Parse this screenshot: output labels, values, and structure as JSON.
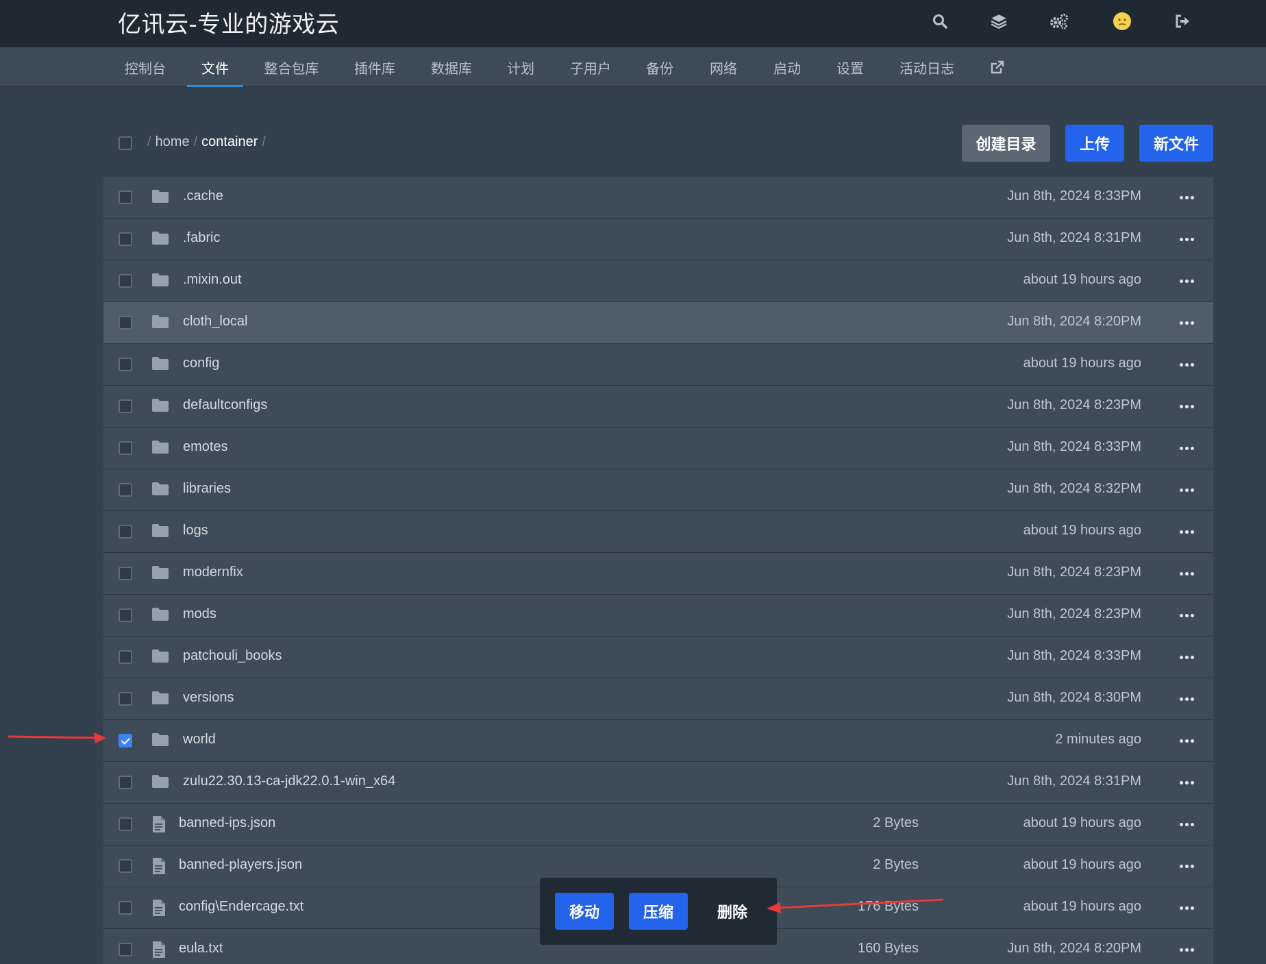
{
  "brand": "亿讯云-专业的游戏云",
  "top_icons": [
    "search-icon",
    "layers-icon",
    "gears-icon",
    "avatar-emoji-icon",
    "sign-out-icon"
  ],
  "nav": {
    "items": [
      {
        "label": "控制台"
      },
      {
        "label": "文件",
        "active": true
      },
      {
        "label": "整合包库"
      },
      {
        "label": "插件库"
      },
      {
        "label": "数据库"
      },
      {
        "label": "计划"
      },
      {
        "label": "子用户"
      },
      {
        "label": "备份"
      },
      {
        "label": "网络"
      },
      {
        "label": "启动"
      },
      {
        "label": "设置"
      },
      {
        "label": "活动日志"
      }
    ],
    "external_icon": "external-link-icon"
  },
  "breadcrumb": {
    "sep": "/",
    "home": "home",
    "current": "container"
  },
  "actions": {
    "create_dir": "创建目录",
    "upload": "上传",
    "new_file": "新文件"
  },
  "files": [
    {
      "name": ".cache",
      "type": "folder",
      "size": "",
      "date": "Jun 8th, 2024 8:33PM",
      "checked": false
    },
    {
      "name": ".fabric",
      "type": "folder",
      "size": "",
      "date": "Jun 8th, 2024 8:31PM",
      "checked": false
    },
    {
      "name": ".mixin.out",
      "type": "folder",
      "size": "",
      "date": "about 19 hours ago",
      "checked": false
    },
    {
      "name": "cloth_local",
      "type": "folder",
      "size": "",
      "date": "Jun 8th, 2024 8:20PM",
      "checked": false,
      "hover": true
    },
    {
      "name": "config",
      "type": "folder",
      "size": "",
      "date": "about 19 hours ago",
      "checked": false
    },
    {
      "name": "defaultconfigs",
      "type": "folder",
      "size": "",
      "date": "Jun 8th, 2024 8:23PM",
      "checked": false
    },
    {
      "name": "emotes",
      "type": "folder",
      "size": "",
      "date": "Jun 8th, 2024 8:33PM",
      "checked": false
    },
    {
      "name": "libraries",
      "type": "folder",
      "size": "",
      "date": "Jun 8th, 2024 8:32PM",
      "checked": false
    },
    {
      "name": "logs",
      "type": "folder",
      "size": "",
      "date": "about 19 hours ago",
      "checked": false
    },
    {
      "name": "modernfix",
      "type": "folder",
      "size": "",
      "date": "Jun 8th, 2024 8:23PM",
      "checked": false
    },
    {
      "name": "mods",
      "type": "folder",
      "size": "",
      "date": "Jun 8th, 2024 8:23PM",
      "checked": false
    },
    {
      "name": "patchouli_books",
      "type": "folder",
      "size": "",
      "date": "Jun 8th, 2024 8:33PM",
      "checked": false
    },
    {
      "name": "versions",
      "type": "folder",
      "size": "",
      "date": "Jun 8th, 2024 8:30PM",
      "checked": false
    },
    {
      "name": "world",
      "type": "folder",
      "size": "",
      "date": "2 minutes ago",
      "checked": true
    },
    {
      "name": "zulu22.30.13-ca-jdk22.0.1-win_x64",
      "type": "folder",
      "size": "",
      "date": "Jun 8th, 2024 8:31PM",
      "checked": false
    },
    {
      "name": "banned-ips.json",
      "type": "file",
      "size": "2 Bytes",
      "date": "about 19 hours ago",
      "checked": false
    },
    {
      "name": "banned-players.json",
      "type": "file",
      "size": "2 Bytes",
      "date": "about 19 hours ago",
      "checked": false
    },
    {
      "name": "config\\Endercage.txt",
      "type": "file",
      "size": "176 Bytes",
      "date": "about 19 hours ago",
      "checked": false
    },
    {
      "name": "eula.txt",
      "type": "file",
      "size": "160 Bytes",
      "date": "Jun 8th, 2024 8:20PM",
      "checked": false
    }
  ],
  "mass_actions": {
    "move": "移动",
    "compress": "压缩",
    "delete": "删除"
  },
  "colors": {
    "accent": "#2463eb",
    "annotation_arrow": "#e83a3a",
    "header_bg": "#1f2933",
    "page_bg": "#33404d"
  }
}
